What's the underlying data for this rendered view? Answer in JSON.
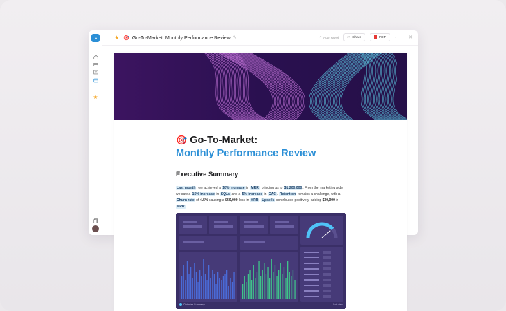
{
  "toolbar": {
    "emoji": "🎯",
    "title": "Go-To-Market: Monthly Performance Review",
    "autosaved": "Auto saved",
    "share_label": "Share",
    "pdf_label": "PDF",
    "more_label": "···"
  },
  "sidebar": {
    "items": [
      "home-icon",
      "inbox-icon",
      "docs-icon",
      "calendar-icon",
      "more-icon",
      "star-icon"
    ],
    "bottom": [
      "pages-icon",
      "avatar"
    ]
  },
  "document": {
    "emoji": "🎯",
    "title_line1": "Go-To-Market:",
    "title_line2": "Monthly Performance Review",
    "section_title": "Executive Summary",
    "paragraph": [
      {
        "t": "Last month",
        "hl": true
      },
      {
        "t": ", we achieved a "
      },
      {
        "t": "18% increase",
        "hl": true
      },
      {
        "t": " in "
      },
      {
        "t": "MRR",
        "hl": true
      },
      {
        "t": ", bringing us to "
      },
      {
        "t": "$1,200,000",
        "hl": true
      },
      {
        "t": ". From the marketing side, we saw a "
      },
      {
        "t": "15% increase",
        "hl": true
      },
      {
        "t": " in "
      },
      {
        "t": "SQLs",
        "hl": true
      },
      {
        "t": " and a "
      },
      {
        "t": "5% increase",
        "hl": true
      },
      {
        "t": " in "
      },
      {
        "t": "CAC",
        "hl": true
      },
      {
        "t": ". "
      },
      {
        "t": "Retention",
        "hl": true
      },
      {
        "t": " remains a challenge, with a "
      },
      {
        "t": "Churn rate",
        "hl": true
      },
      {
        "t": " of "
      },
      {
        "t": "4.5%",
        "b": true
      },
      {
        "t": " causing a "
      },
      {
        "t": "$50,000",
        "b": true
      },
      {
        "t": " loss in "
      },
      {
        "t": "MRR",
        "hl": true
      },
      {
        "t": ". "
      },
      {
        "t": "Upsells",
        "hl": true
      },
      {
        "t": " contributed positively, adding "
      },
      {
        "t": "$30,000",
        "b": true
      },
      {
        "t": " in "
      },
      {
        "t": "MRR",
        "hl": true
      },
      {
        "t": "."
      }
    ]
  },
  "dashboard": {
    "brand": "Optimize Summary",
    "corner": "Sort view",
    "gauge_fraction": 0.78,
    "bars_series_1": [
      0.55,
      0.8,
      0.45,
      0.9,
      0.6,
      0.75,
      0.5,
      0.85,
      0.65,
      0.4,
      0.7,
      0.55,
      0.95,
      0.6,
      0.45,
      0.8,
      0.5,
      0.7,
      0.6,
      0.35,
      0.65,
      0.5,
      0.45,
      0.55,
      0.6,
      0.7,
      0.3,
      0.5,
      0.4,
      0.65
    ],
    "bars_series_2": [
      0.35,
      0.55,
      0.4,
      0.6,
      0.7,
      0.45,
      0.8,
      0.5,
      0.65,
      0.9,
      0.55,
      0.7,
      0.85,
      0.6,
      0.75,
      0.5,
      0.95,
      0.65,
      0.8,
      0.55,
      0.7,
      0.85,
      0.6,
      0.75,
      0.5,
      0.9,
      0.65,
      0.55,
      0.7,
      0.45
    ],
    "colors": {
      "series_1": "#4a6bd8",
      "series_2": "#3fc38a",
      "gauge": "#4fc3f7",
      "background": "#3a2f67"
    }
  },
  "colors": {
    "accent": "#2b8fd6",
    "highlight_bg": "#dcedf7"
  }
}
